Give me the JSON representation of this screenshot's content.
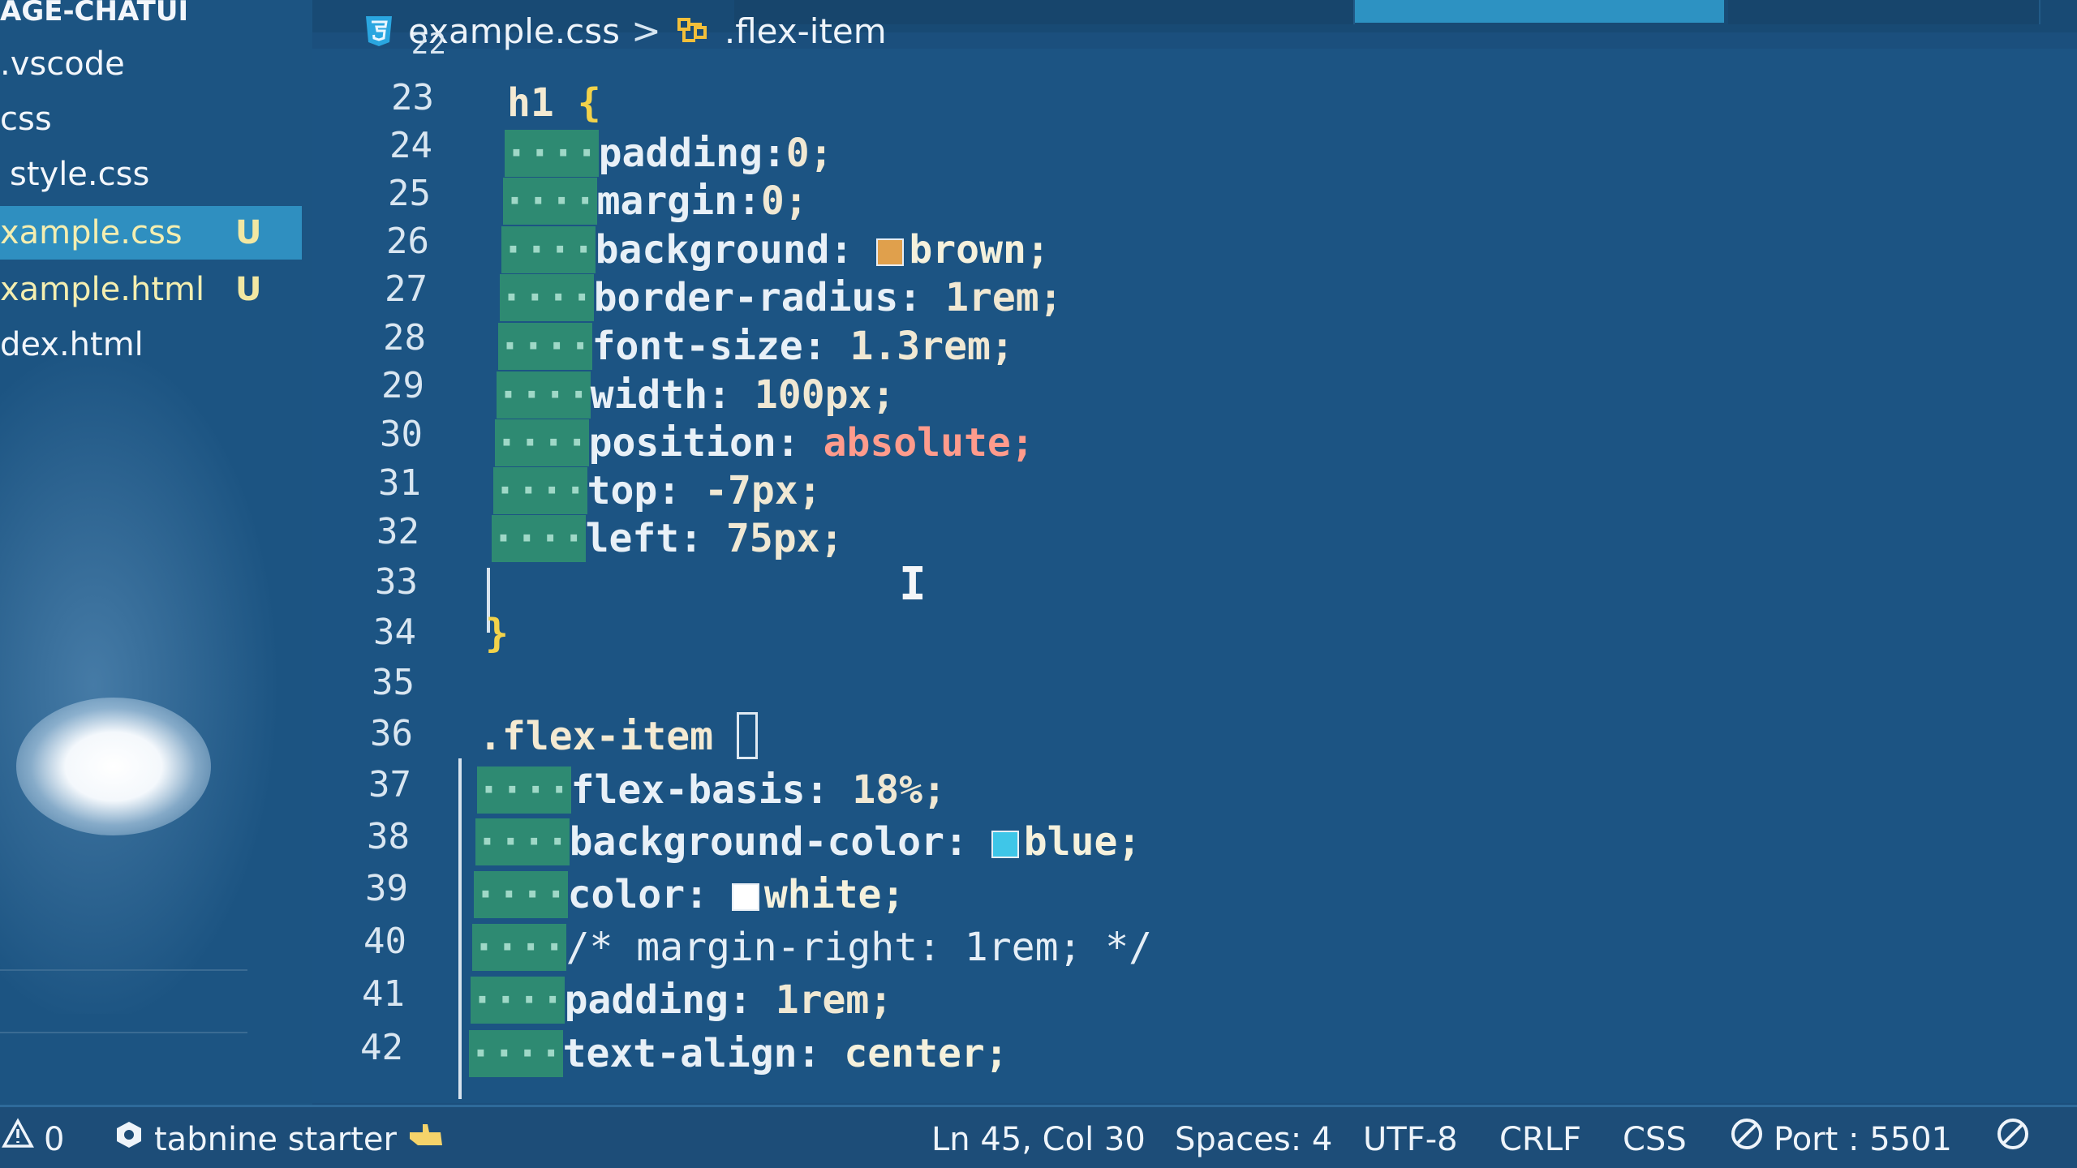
{
  "sidebar": {
    "header": "AGE-CHATUI",
    "items": [
      {
        "label": ".vscode",
        "status": ""
      },
      {
        "label": "css",
        "status": ""
      },
      {
        "label": "style.css",
        "status": ""
      },
      {
        "label": "xample.css",
        "status": "U",
        "selected": true
      },
      {
        "label": "xample.html",
        "status": "U"
      },
      {
        "label": "dex.html",
        "status": ""
      }
    ]
  },
  "breadcrumb": {
    "file": "example.css",
    "separator": ">",
    "symbol": ".flex-item",
    "file_icon": "css3-icon",
    "symbol_icon": "symbol-class-icon"
  },
  "editor": {
    "line_numbers": [
      "22",
      "23",
      "24",
      "25",
      "26",
      "27",
      "28",
      "29",
      "30",
      "31",
      "32",
      "33",
      "34",
      "35",
      "36",
      "37",
      "38",
      "39",
      "40",
      "41",
      "42"
    ],
    "indent_glyph": "····",
    "lines": {
      "l23": {
        "selector": "h1",
        "brace": "{"
      },
      "l24": {
        "prop": "padding:",
        "val": "0;"
      },
      "l25": {
        "prop": "margin:",
        "val": "0;"
      },
      "l26": {
        "prop": "background: ",
        "val": "brown;",
        "swatch": "#e0a04c"
      },
      "l27": {
        "prop": "border-radius: ",
        "val": "1rem;"
      },
      "l28": {
        "prop": "font-size: ",
        "val": "1.3rem;"
      },
      "l29": {
        "prop": "width: ",
        "val": "100px;"
      },
      "l30": {
        "prop": "position: ",
        "val": "absolute;"
      },
      "l31": {
        "prop": "top: ",
        "val": "-7px;"
      },
      "l32": {
        "prop": "left: ",
        "val": "75px;"
      },
      "l34": {
        "brace": "}"
      },
      "l36": {
        "selector": ".flex-item "
      },
      "l37": {
        "prop": "flex-basis: ",
        "val": "18%;"
      },
      "l38": {
        "prop": "background-color: ",
        "val": "blue;",
        "swatch": "#3fc6e8"
      },
      "l39": {
        "prop": "color: ",
        "val": "white;",
        "swatch": "#ffffff"
      },
      "l40": {
        "comment": "/* margin-right: 1rem; */"
      },
      "l41": {
        "prop": "padding: ",
        "val": "1rem;"
      },
      "l42": {
        "prop": "text-align: ",
        "val": "center;"
      }
    }
  },
  "statusbar": {
    "problems_count": "0",
    "tabnine": "tabnine starter",
    "cursor_pos": "Ln 45, Col 30",
    "spaces": "Spaces: 4",
    "encoding": "UTF-8",
    "eol": "CRLF",
    "language": "CSS",
    "port": "Port : 5501"
  },
  "colors": {
    "editor_bg": "#1c5483",
    "selection": "#2f8fc0",
    "indent_guide": "#2e8a72",
    "keyword_value": "#ff9b8c"
  }
}
